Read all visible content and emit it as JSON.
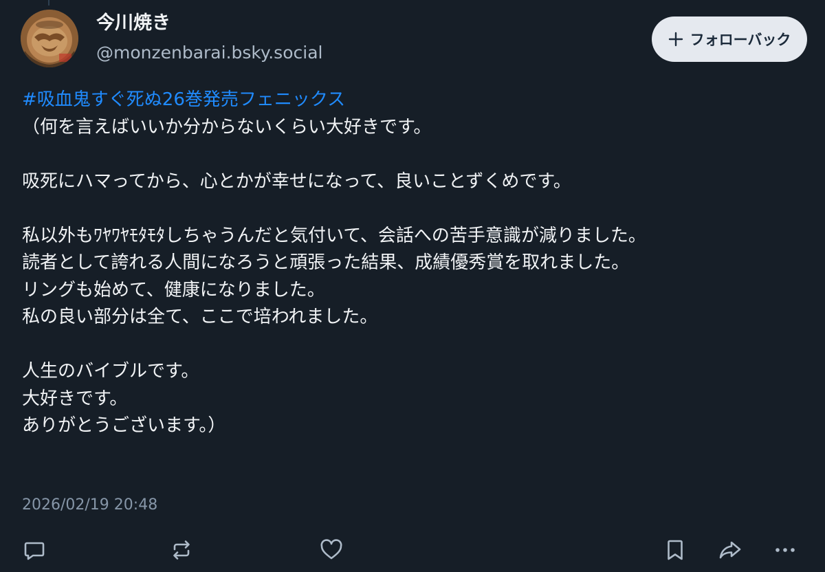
{
  "author": {
    "display_name": "今川焼き",
    "handle": "@monzenbarai.bsky.social",
    "avatar_icon": "avatar-image"
  },
  "follow_button": {
    "label": "フォローバック",
    "icon": "plus-icon"
  },
  "post": {
    "hashtag": "#吸血鬼すぐ死ぬ26巻発売フェニックス",
    "lines": [
      "（何を言えばいいか分からないくらい大好きです。",
      "",
      "吸死にハマってから、心とかが幸せになって、良いことずくめです。",
      "",
      "私以外もﾜﾔﾜﾔﾓﾀﾓﾀしちゃうんだと気付いて、会話への苦手意識が減りました。",
      "読者として誇れる人間になろうと頑張った結果、成績優秀賞を取れました。",
      "リングも始めて、健康になりました。",
      "私の良い部分は全て、ここで培われました。",
      "",
      "人生のバイブルです。",
      "大好きです。",
      "ありがとうございます。）"
    ],
    "timestamp": "2026/02/19 20:48"
  },
  "actions": [
    {
      "name": "reply",
      "icon": "reply-icon"
    },
    {
      "name": "repost",
      "icon": "repost-icon"
    },
    {
      "name": "like",
      "icon": "heart-icon"
    },
    {
      "name": "bookmark",
      "icon": "bookmark-icon"
    },
    {
      "name": "share",
      "icon": "share-icon"
    },
    {
      "name": "more",
      "icon": "more-icon"
    }
  ],
  "colors": {
    "background": "#161e27",
    "text": "#f1f3f5",
    "handle": "#aebbc9",
    "hashtag": "#208bfe",
    "timestamp": "#8696a8",
    "icon": "#aebbc9",
    "follow_button_bg": "#e5e9ef"
  }
}
